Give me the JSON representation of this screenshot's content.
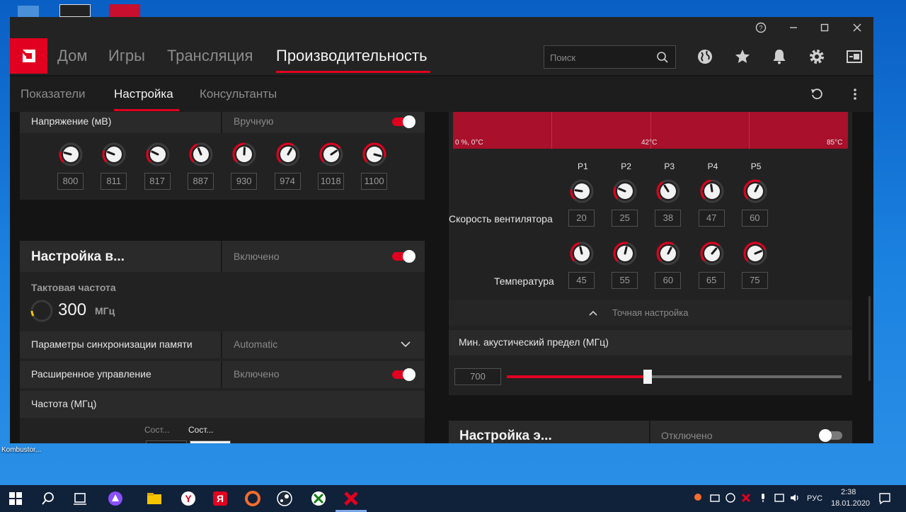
{
  "desktop": {
    "labels": [
      "Kombustor..."
    ]
  },
  "nav": {
    "items": [
      "Дом",
      "Игры",
      "Трансляция",
      "Производительность"
    ],
    "search_placeholder": "Поиск"
  },
  "subnav": {
    "items": [
      "Показатели",
      "Настройка",
      "Консультанты"
    ]
  },
  "voltage": {
    "label": "Напряжение (мВ)",
    "mode": "Вручную",
    "values": [
      "800",
      "811",
      "817",
      "887",
      "930",
      "974",
      "1018",
      "1100"
    ]
  },
  "memory_card": {
    "title": "Настройка в...",
    "state": "Включено",
    "clock_label": "Тактовая частота",
    "clock_value": "300",
    "clock_unit": "МГц",
    "sync_label": "Параметры синхронизации памяти",
    "sync_value": "Automatic",
    "advanced_label": "Расширенное управление",
    "advanced_value": "Включено",
    "freq_label": "Частота (МГц)",
    "col_a": "Сост...",
    "col_b": "Сост..."
  },
  "fan": {
    "chart_labels": [
      "0 %, 0°C",
      "42°C",
      "85°C"
    ],
    "states": [
      "P1",
      "P2",
      "P3",
      "P4",
      "P5"
    ],
    "speed_label": "Скорость вентилятора",
    "speeds": [
      "20",
      "25",
      "38",
      "47",
      "60"
    ],
    "temp_label": "Температура",
    "temps": [
      "45",
      "55",
      "60",
      "65",
      "75"
    ],
    "fine_tune": "Точная настройка",
    "acoustic_label": "Мин. акустический предел (МГц)",
    "acoustic_value": "700",
    "acoustic_fraction": 0.42
  },
  "power_card": {
    "title": "Настройка э...",
    "state": "Отключено"
  },
  "taskbar": {
    "lang": "РУС",
    "time": "2:38",
    "date": "18.01.2020"
  },
  "colors": {
    "accent": "#e1001f",
    "panel": "#222222"
  }
}
